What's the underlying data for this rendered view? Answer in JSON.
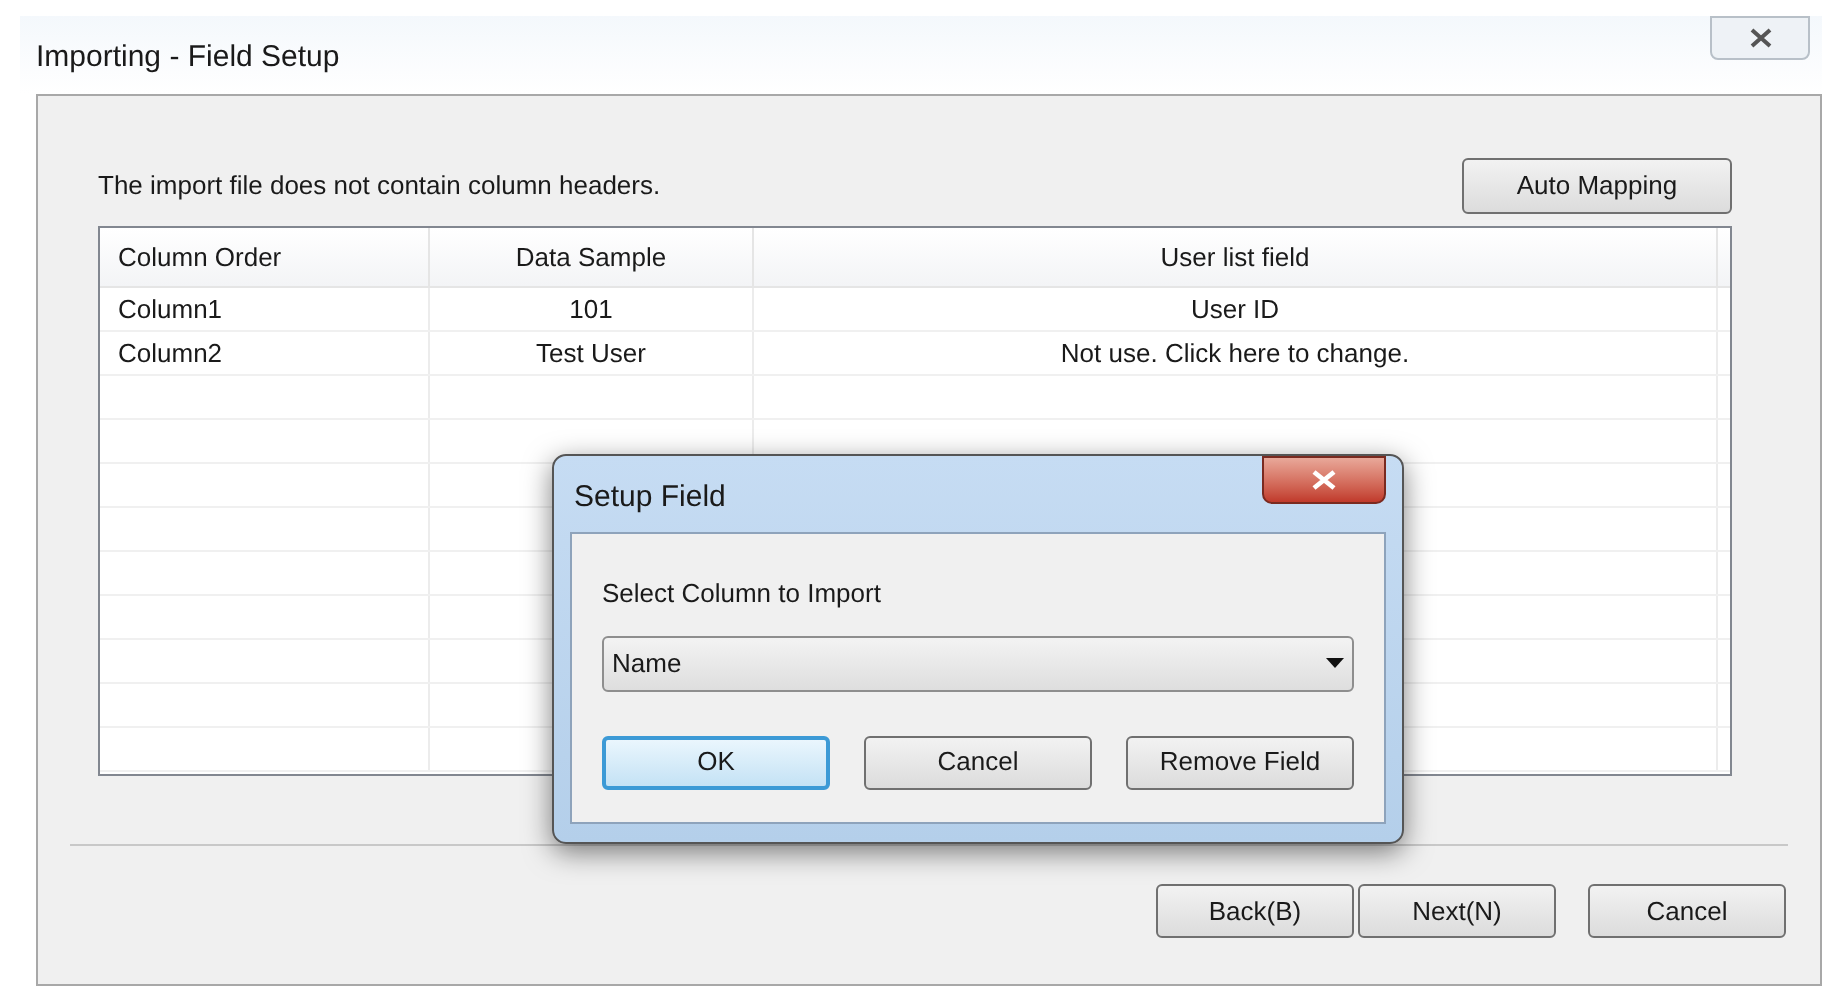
{
  "window": {
    "title": "Importing - Field Setup"
  },
  "message": "The import file does not contain column headers.",
  "auto_mapping_button": "Auto Mapping",
  "table": {
    "columns": [
      "Column Order",
      "Data Sample",
      "User list field"
    ],
    "rows": [
      [
        "Column1",
        "101",
        "User ID"
      ],
      [
        "Column2",
        "Test User",
        "Not use. Click here to change."
      ]
    ]
  },
  "buttons": [
    {
      "label": "Back(B)"
    },
    {
      "label": "Next(N)"
    },
    {
      "label": "Cancel"
    }
  ],
  "dialog": {
    "title": "Setup Field",
    "label": "Select Column to Import",
    "dropdown": {
      "value": "Name"
    },
    "buttons": [
      {
        "label": "OK",
        "default": true
      },
      {
        "label": "Cancel",
        "default": false
      },
      {
        "label": "Remove Field",
        "default": false
      }
    ]
  }
}
